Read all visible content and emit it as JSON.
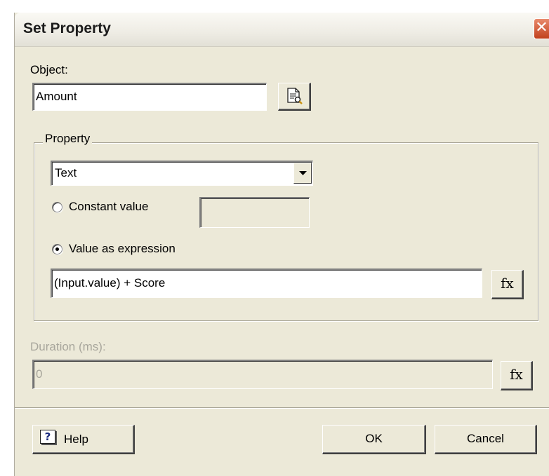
{
  "window": {
    "title": "Set Property",
    "close_glyph": "✕"
  },
  "object": {
    "label": "Object:",
    "value": "Amount",
    "browse_icon": "document-browse-icon"
  },
  "property": {
    "group_label": "Property",
    "selected": "Text",
    "options": [
      "Text"
    ],
    "constant_label": "Constant value",
    "constant_value": "",
    "constant_selected": false,
    "expression_label": "Value as expression",
    "expression_selected": true,
    "expression_value": "(Input.value) + Score",
    "fx_label": "fx"
  },
  "duration": {
    "label": "Duration (ms):",
    "value": "0",
    "enabled": false,
    "fx_label": "fx"
  },
  "buttons": {
    "help": "Help",
    "ok": "OK",
    "cancel": "Cancel"
  },
  "colors": {
    "dialog_bg": "#ece9d8",
    "close_button": "#c1401c",
    "disabled_text": "#a8a69c"
  }
}
